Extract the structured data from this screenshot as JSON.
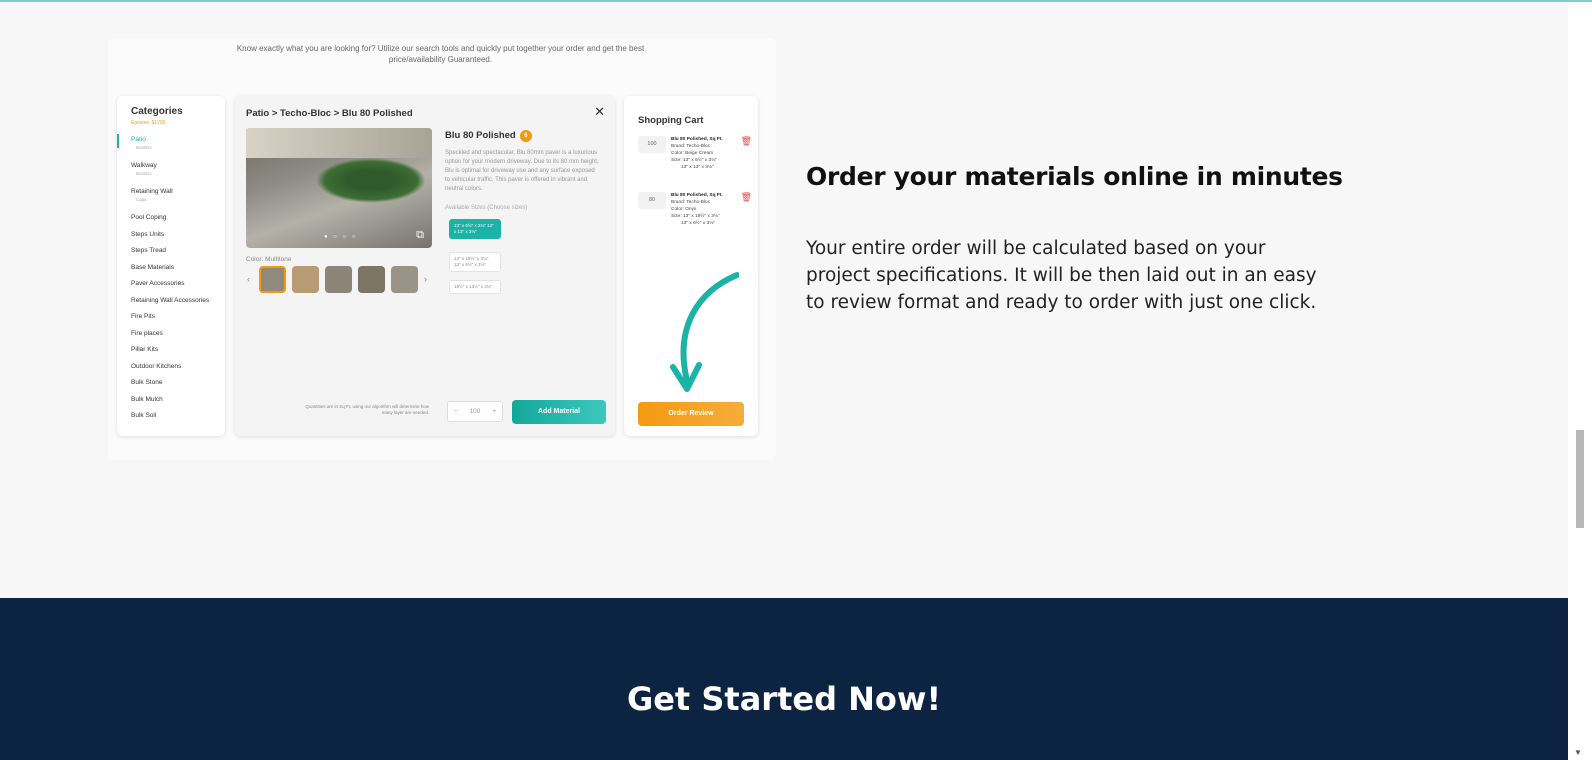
{
  "intro": "Know exactly what you are looking for? Utilize our search tools and quickly put together your order and get the best price/availability Guaranteed.",
  "categories": {
    "title": "Categories",
    "subtitle": "Epoxies: $1795",
    "items": [
      {
        "label": "Patio",
        "sub": "Borders"
      },
      {
        "label": "Walkway",
        "sub": "Borders"
      },
      {
        "label": "Retaining Wall",
        "sub": "Caps"
      },
      {
        "label": "Pool Coping"
      },
      {
        "label": "Steps Units"
      },
      {
        "label": "Steps Tread"
      },
      {
        "label": "Base Materials"
      },
      {
        "label": "Paver Accessories"
      },
      {
        "label": "Retaining Wall Accessories"
      },
      {
        "label": "Fire Pits"
      },
      {
        "label": "Fire places"
      },
      {
        "label": "Pillar Kits"
      },
      {
        "label": "Outdoor Kitchens"
      },
      {
        "label": "Bulk Stone"
      },
      {
        "label": "Bulk Mulch"
      },
      {
        "label": "Bulk Soil"
      }
    ]
  },
  "product": {
    "breadcrumb": "Patio > Techo-Bloc > Blu 80 Polished",
    "close": "✕",
    "name": "Blu 80 Polished",
    "badge": "6",
    "description": "Speckled and spectacular, Blu 80mm paver is a luxurious option for your modern driveway. Due to its 80 mm height, Blu is optimal for driveway use and any surface exposed to vehicular traffic. This paver is offered in vibrant and neutral colors.",
    "sizes_label": "Available Sizes (Choose sizes)",
    "sizes": [
      "13\" x 6½\" x 3⅛\"  13\" x 13\" x 3⅛\"",
      "13\" x 19½\" x 3⅛\"  13\" x 6½\" x 3⅛\"",
      "19½\" x 13½\" x 3⅛\""
    ],
    "color_label": "Color: Multitone",
    "swatch_colors": [
      "#8f8a7c",
      "#b89a75",
      "#8c8577",
      "#7d7564",
      "#9a9388"
    ],
    "quantity_note": "Quantities are in Sq Ft, using our algorithm will determine how many layer are needed.",
    "quantity": "100",
    "qty_minus": "−",
    "qty_plus": "+",
    "add_button": "Add Material"
  },
  "cart": {
    "title": "Shopping Cart",
    "items": [
      {
        "qty": "100",
        "name": "Blu 80 Polished, Sq Ft.",
        "lines": [
          "Brand: Techo-Bloc",
          "Color: Beige Cream",
          "Size: 13\" x 6½\" x 3⅛\"",
          "13\" x 13\" x 3⅛\""
        ]
      },
      {
        "qty": "80",
        "name": "Blu 80 Polished, Sq Ft.",
        "lines": [
          "Brand: Techo-Bloc",
          "Color: Onyx",
          "Size: 13\" x 19½\" x 3⅛\"",
          "13\" x 6½\" x 3⅛\""
        ]
      }
    ],
    "order_button": "Order Review"
  },
  "headline": "Order your materials online in minutes",
  "body": "Your entire order will be calculated based on your project specifications. It will be then laid out in an easy to review format and ready to order with just one click.",
  "cta": "Get Started Now!",
  "colors": {
    "teal": "#1ab3a6",
    "orange": "#f39a12",
    "navy": "#0c2441"
  }
}
